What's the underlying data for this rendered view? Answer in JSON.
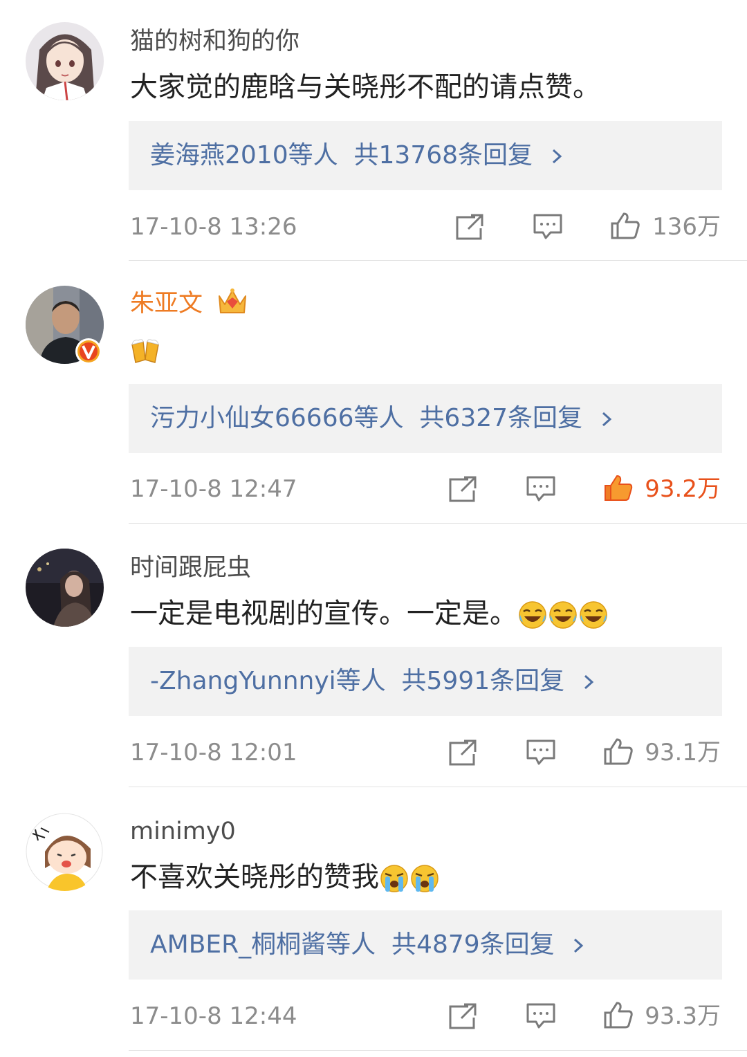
{
  "comments": [
    {
      "username": "猫的树和狗的你",
      "text": "大家觉的鹿晗与关晓彤不配的请点赞。",
      "reply_users": "姜海燕2010等人",
      "reply_total": "共13768条回复",
      "time": "17-10-8 13:26",
      "likes": "136万",
      "liked": false
    },
    {
      "username": "朱亚文",
      "text": "",
      "emoji": "cheers-beer-emoji",
      "reply_users": "污力小仙女66666等人",
      "reply_total": "共6327条回复",
      "time": "17-10-8 12:47",
      "likes": "93.2万",
      "liked": true,
      "verified": true
    },
    {
      "username": "时间跟屁虫",
      "text": "一定是电视剧的宣传。一定是。",
      "emoji": "laugh-cry-emoji",
      "reply_users": "-ZhangYunnnyi等人",
      "reply_total": "共5991条回复",
      "time": "17-10-8 12:01",
      "likes": "93.1万",
      "liked": false
    },
    {
      "username": "minimy0",
      "text": "不喜欢关晓彤的赞我",
      "emoji": "crying-emoji",
      "reply_users": "AMBER_桐桐酱等人",
      "reply_total": "共4879条回复",
      "time": "17-10-8 12:44",
      "likes": "93.3万",
      "liked": false
    }
  ],
  "colors": {
    "link_blue": "#4e6fa3",
    "vip_orange": "#ee7b23",
    "liked_orange": "#e8511b",
    "meta_gray": "#8c8c8c",
    "reply_bg": "#f2f2f2"
  }
}
